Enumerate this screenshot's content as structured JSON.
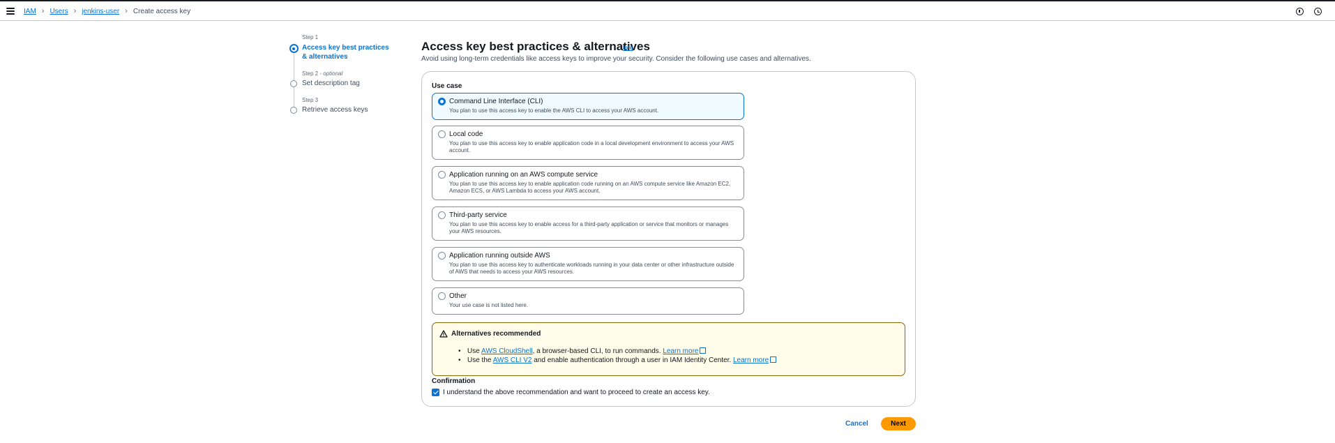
{
  "breadcrumb": {
    "items": [
      "IAM",
      "Users",
      "jenkins-user"
    ],
    "current": "Create access key"
  },
  "steps": [
    {
      "label": "Step 1",
      "title": "Access key best practices & alternatives",
      "active": true
    },
    {
      "label": "Step 2",
      "optional": "optional",
      "title": "Set description tag",
      "active": false
    },
    {
      "label": "Step 3",
      "title": "Retrieve access keys",
      "active": false
    }
  ],
  "page": {
    "title": "Access key best practices & alternatives",
    "info": "Info",
    "description": "Avoid using long-term credentials like access keys to improve your security. Consider the following use cases and alternatives."
  },
  "use_case": {
    "label": "Use case",
    "selected": "Command Line Interface (CLI)",
    "options": [
      {
        "title": "Command Line Interface (CLI)",
        "desc": "You plan to use this access key to enable the AWS CLI to access your AWS account."
      },
      {
        "title": "Local code",
        "desc": "You plan to use this access key to enable application code in a local development environment to access your AWS account."
      },
      {
        "title": "Application running on an AWS compute service",
        "desc": "You plan to use this access key to enable application code running on an AWS compute service like Amazon EC2, Amazon ECS, or AWS Lambda to access your AWS account."
      },
      {
        "title": "Third-party service",
        "desc": "You plan to use this access key to enable access for a third-party application or service that monitors or manages your AWS resources."
      },
      {
        "title": "Application running outside AWS",
        "desc": "You plan to use this access key to authenticate workloads running in your data center or other infrastructure outside of AWS that needs to access your AWS resources."
      },
      {
        "title": "Other",
        "desc": "Your use case is not listed here."
      }
    ]
  },
  "alert": {
    "title": "Alternatives recommended",
    "item1": {
      "pre": "Use ",
      "link": "AWS CloudShell",
      "post": ", a browser-based CLI, to run commands. ",
      "learn": "Learn more"
    },
    "item2": {
      "pre": "Use the ",
      "link": "AWS CLI V2",
      "post": " and enable authentication through a user in IAM Identity Center. ",
      "learn": "Learn more"
    }
  },
  "confirmation": {
    "label": "Confirmation",
    "text": "I understand the above recommendation and want to proceed to create an access key.",
    "checked": true
  },
  "buttons": {
    "cancel": "Cancel",
    "next": "Next"
  },
  "colors": {
    "accent": "#0972d3",
    "primary_button": "#ff9900",
    "warning_border": "#8d6605",
    "warning_bg": "#fffce9"
  }
}
